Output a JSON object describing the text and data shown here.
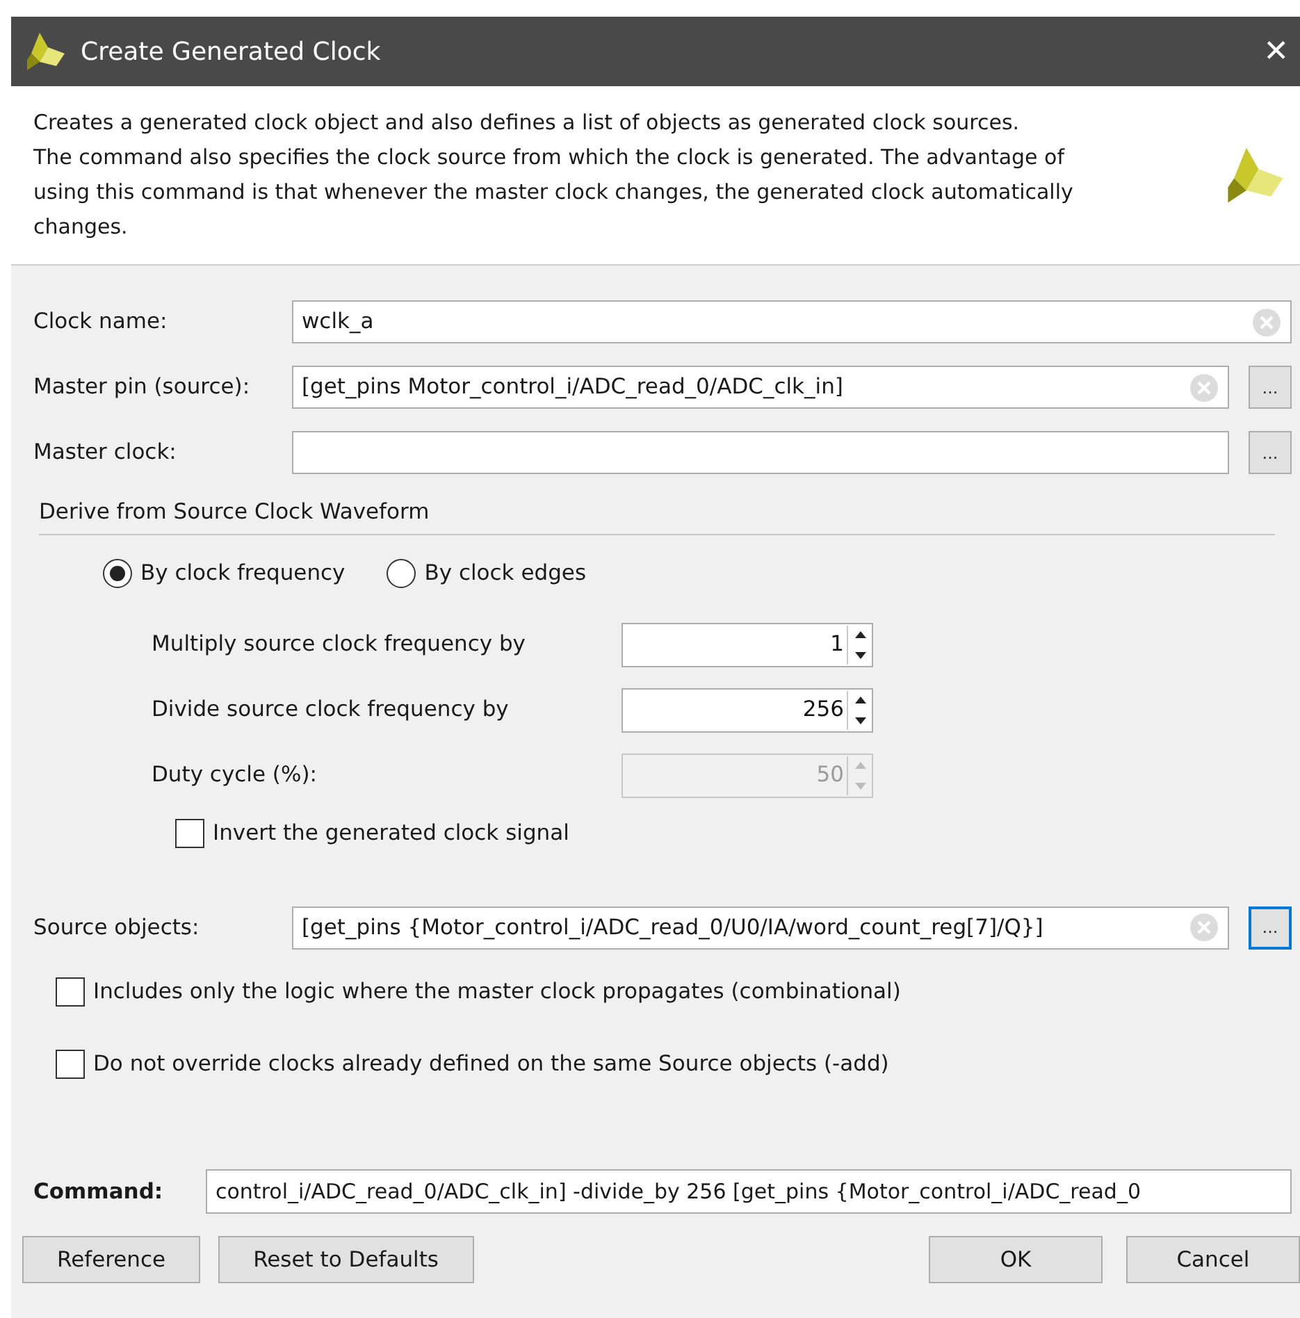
{
  "window": {
    "title": "Create Generated Clock",
    "close": "✕"
  },
  "description": {
    "lines": [
      "Creates a generated clock object and also defines a list of objects as generated clock sources.",
      "The command also specifies the clock source from which the clock is generated. The advantage of",
      "using this command is that whenever the master clock changes, the generated clock automatically",
      "changes."
    ]
  },
  "fields": [
    {
      "label": "Clock name:",
      "value": "wclk_a"
    },
    {
      "label": "Master pin (source):",
      "value": "[get_pins Motor_control_i/ADC_read_0/ADC_clk_in]",
      "browse_label": "...",
      "focused": false
    },
    {
      "label": "Master clock:",
      "browse_label": "...",
      "focused": false
    }
  ],
  "waveform": {
    "title": "Derive from Source Clock Waveform",
    "options": [
      {
        "label": "By clock frequency",
        "selected": true
      },
      {
        "label": "By clock edges",
        "selected": false
      }
    ],
    "spinners": [
      {
        "label": "Multiply source clock frequency by",
        "value": "1",
        "disabled": false
      },
      {
        "label": "Divide source clock frequency by",
        "value": "256",
        "disabled": false
      },
      {
        "label": "Duty cycle (%):",
        "value": "50",
        "disabled": true
      }
    ],
    "invert": {
      "label": "Invert the generated clock signal",
      "checked": false
    }
  },
  "source_objects": {
    "label": "Source objects:",
    "value": "[get_pins {Motor_control_i/ADC_read_0/U0/IA/word_count_reg[7]/Q}]",
    "browse_label": "...",
    "focused": true
  },
  "options": [
    {
      "label": "Includes only the logic where the master clock propagates (combinational)",
      "checked": false
    },
    {
      "label": "Do not override clocks already defined on the same Source objects (-add)",
      "checked": false
    }
  ],
  "command": {
    "label": "Command:",
    "value": "control_i/ADC_read_0/ADC_clk_in] -divide_by 256 [get_pins {Motor_control_i/ADC_read_0"
  },
  "buttons_left": [
    "Reference",
    "Reset to Defaults"
  ],
  "buttons_right": [
    "OK",
    "Cancel"
  ]
}
